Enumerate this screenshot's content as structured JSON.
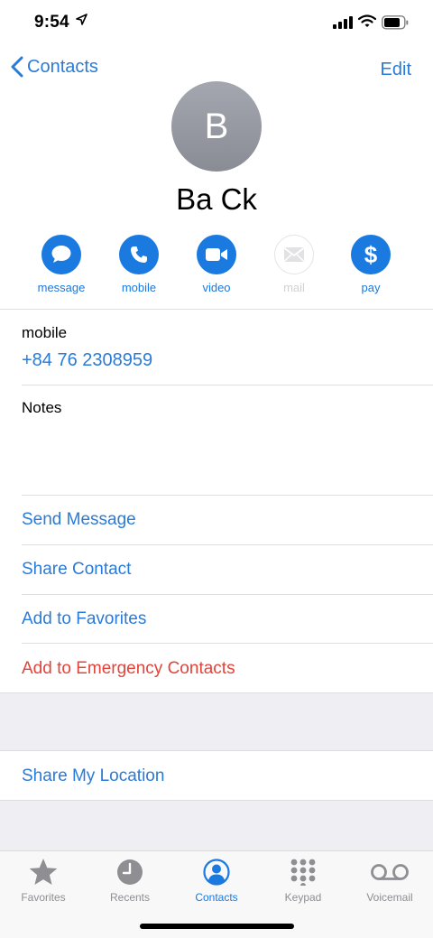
{
  "status": {
    "time": "9:54"
  },
  "nav": {
    "back_label": "Contacts",
    "edit_label": "Edit"
  },
  "contact": {
    "initial": "B",
    "name": "Ba Ck"
  },
  "actions": [
    {
      "label": "message",
      "icon": "message-icon",
      "enabled": true
    },
    {
      "label": "mobile",
      "icon": "phone-icon",
      "enabled": true
    },
    {
      "label": "video",
      "icon": "video-icon",
      "enabled": true
    },
    {
      "label": "mail",
      "icon": "mail-icon",
      "enabled": false
    },
    {
      "label": "pay",
      "icon": "dollar-icon",
      "enabled": true
    }
  ],
  "phone": {
    "label": "mobile",
    "number": "+84 76 2308959"
  },
  "notes": {
    "label": "Notes"
  },
  "links": {
    "send_message": "Send Message",
    "share_contact": "Share Contact",
    "add_favorites": "Add to Favorites",
    "add_emergency": "Add to Emergency Contacts",
    "share_location": "Share My Location"
  },
  "tabs": [
    {
      "label": "Favorites",
      "icon": "star-icon",
      "active": false
    },
    {
      "label": "Recents",
      "icon": "clock-icon",
      "active": false
    },
    {
      "label": "Contacts",
      "icon": "person-circle-icon",
      "active": true
    },
    {
      "label": "Keypad",
      "icon": "keypad-icon",
      "active": false
    },
    {
      "label": "Voicemail",
      "icon": "voicemail-icon",
      "active": false
    }
  ],
  "colors": {
    "accent": "#1a7ae0",
    "link": "#2a7bd8",
    "destructive": "#e0443b",
    "inactive": "#8e8e93"
  }
}
